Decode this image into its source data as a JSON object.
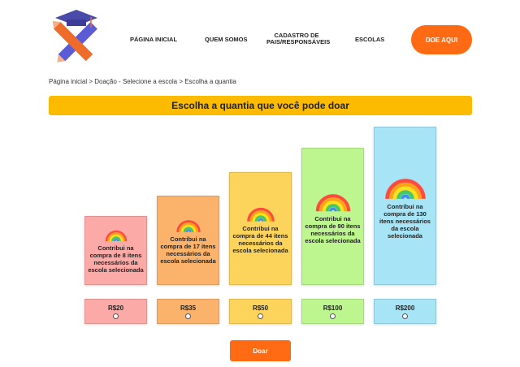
{
  "header": {
    "nav": [
      {
        "label": "PÁGINA INICIAL"
      },
      {
        "label": "QUEM SOMOS"
      },
      {
        "label": "CADASTRO DE PAIS/RESPONSÁVEIS"
      },
      {
        "label": "ESCOLAS"
      }
    ],
    "cta_label": "DOE AQUI"
  },
  "breadcrumb": "Página inicial > Doação - Selecione a escola > Escolha a quantia",
  "banner_title": "Escolha a quantia que você pode doar",
  "options": [
    {
      "description": "Contribui na compra de 8 itens necessários da escola selecionada",
      "amount": "R$20",
      "color": "#fbaaa8"
    },
    {
      "description": "Contribui na compra de 17 itens necessários da escola selecionada",
      "amount": "R$35",
      "color": "#fbb26a"
    },
    {
      "description": "Contribui na compra de 44 itens necessários da escola selecionada",
      "amount": "R$50",
      "color": "#fdd45b"
    },
    {
      "description": "Contribui na compra de 90 itens necessários da escola selecionada",
      "amount": "R$100",
      "color": "#bdf58f"
    },
    {
      "description": "Contribui na compra de 130 itens necessários da escola selecionada",
      "amount": "R$200",
      "color": "#a6e4f6"
    }
  ],
  "donate_label": "Doar",
  "colors": {
    "accent": "#ff6a13",
    "banner": "#fdbb00"
  }
}
